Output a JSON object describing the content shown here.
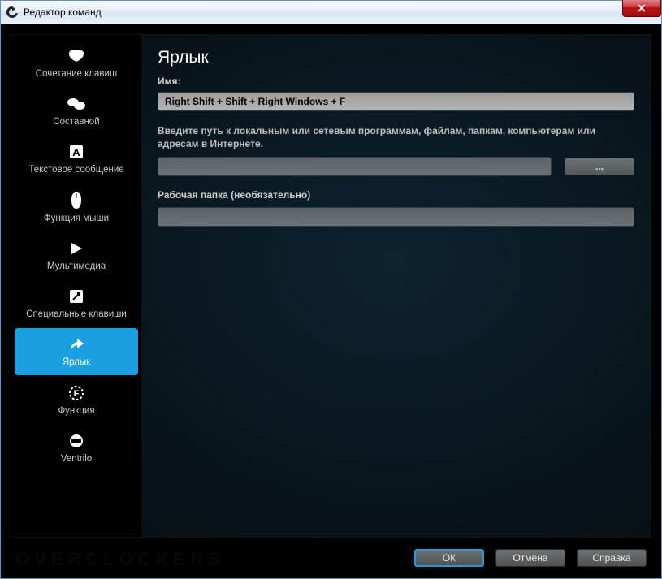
{
  "window": {
    "title": "Редактор команд"
  },
  "sidebar": {
    "items": [
      {
        "label": "Сочетание клавиш",
        "icon": "keyboard-combo"
      },
      {
        "label": "Составной",
        "icon": "multi-key"
      },
      {
        "label": "Текстовое сообщение",
        "icon": "text-block"
      },
      {
        "label": "Функция мыши",
        "icon": "mouse"
      },
      {
        "label": "Мультимедиа",
        "icon": "play"
      },
      {
        "label": "Специальные клавиши",
        "icon": "hotkey"
      },
      {
        "label": "Ярлык",
        "icon": "shortcut",
        "active": true
      },
      {
        "label": "Функция",
        "icon": "function"
      },
      {
        "label": "Ventrilo",
        "icon": "ventrilo"
      }
    ]
  },
  "panel": {
    "heading": "Ярлык",
    "name_label": "Имя:",
    "name_value": "Right Shift + Shift + Right Windows + F",
    "path_hint": "Введите путь к локальным или сетевым программам, файлам, папкам, компьютерам или адресам в Интернете.",
    "path_value": "",
    "browse_label": "...",
    "workdir_label": "Рабочая папка (необязательно)",
    "workdir_value": ""
  },
  "footer": {
    "ok": "ОК",
    "cancel": "Отмена",
    "help": "Справка"
  },
  "watermark": "OVERCLOCKERS"
}
